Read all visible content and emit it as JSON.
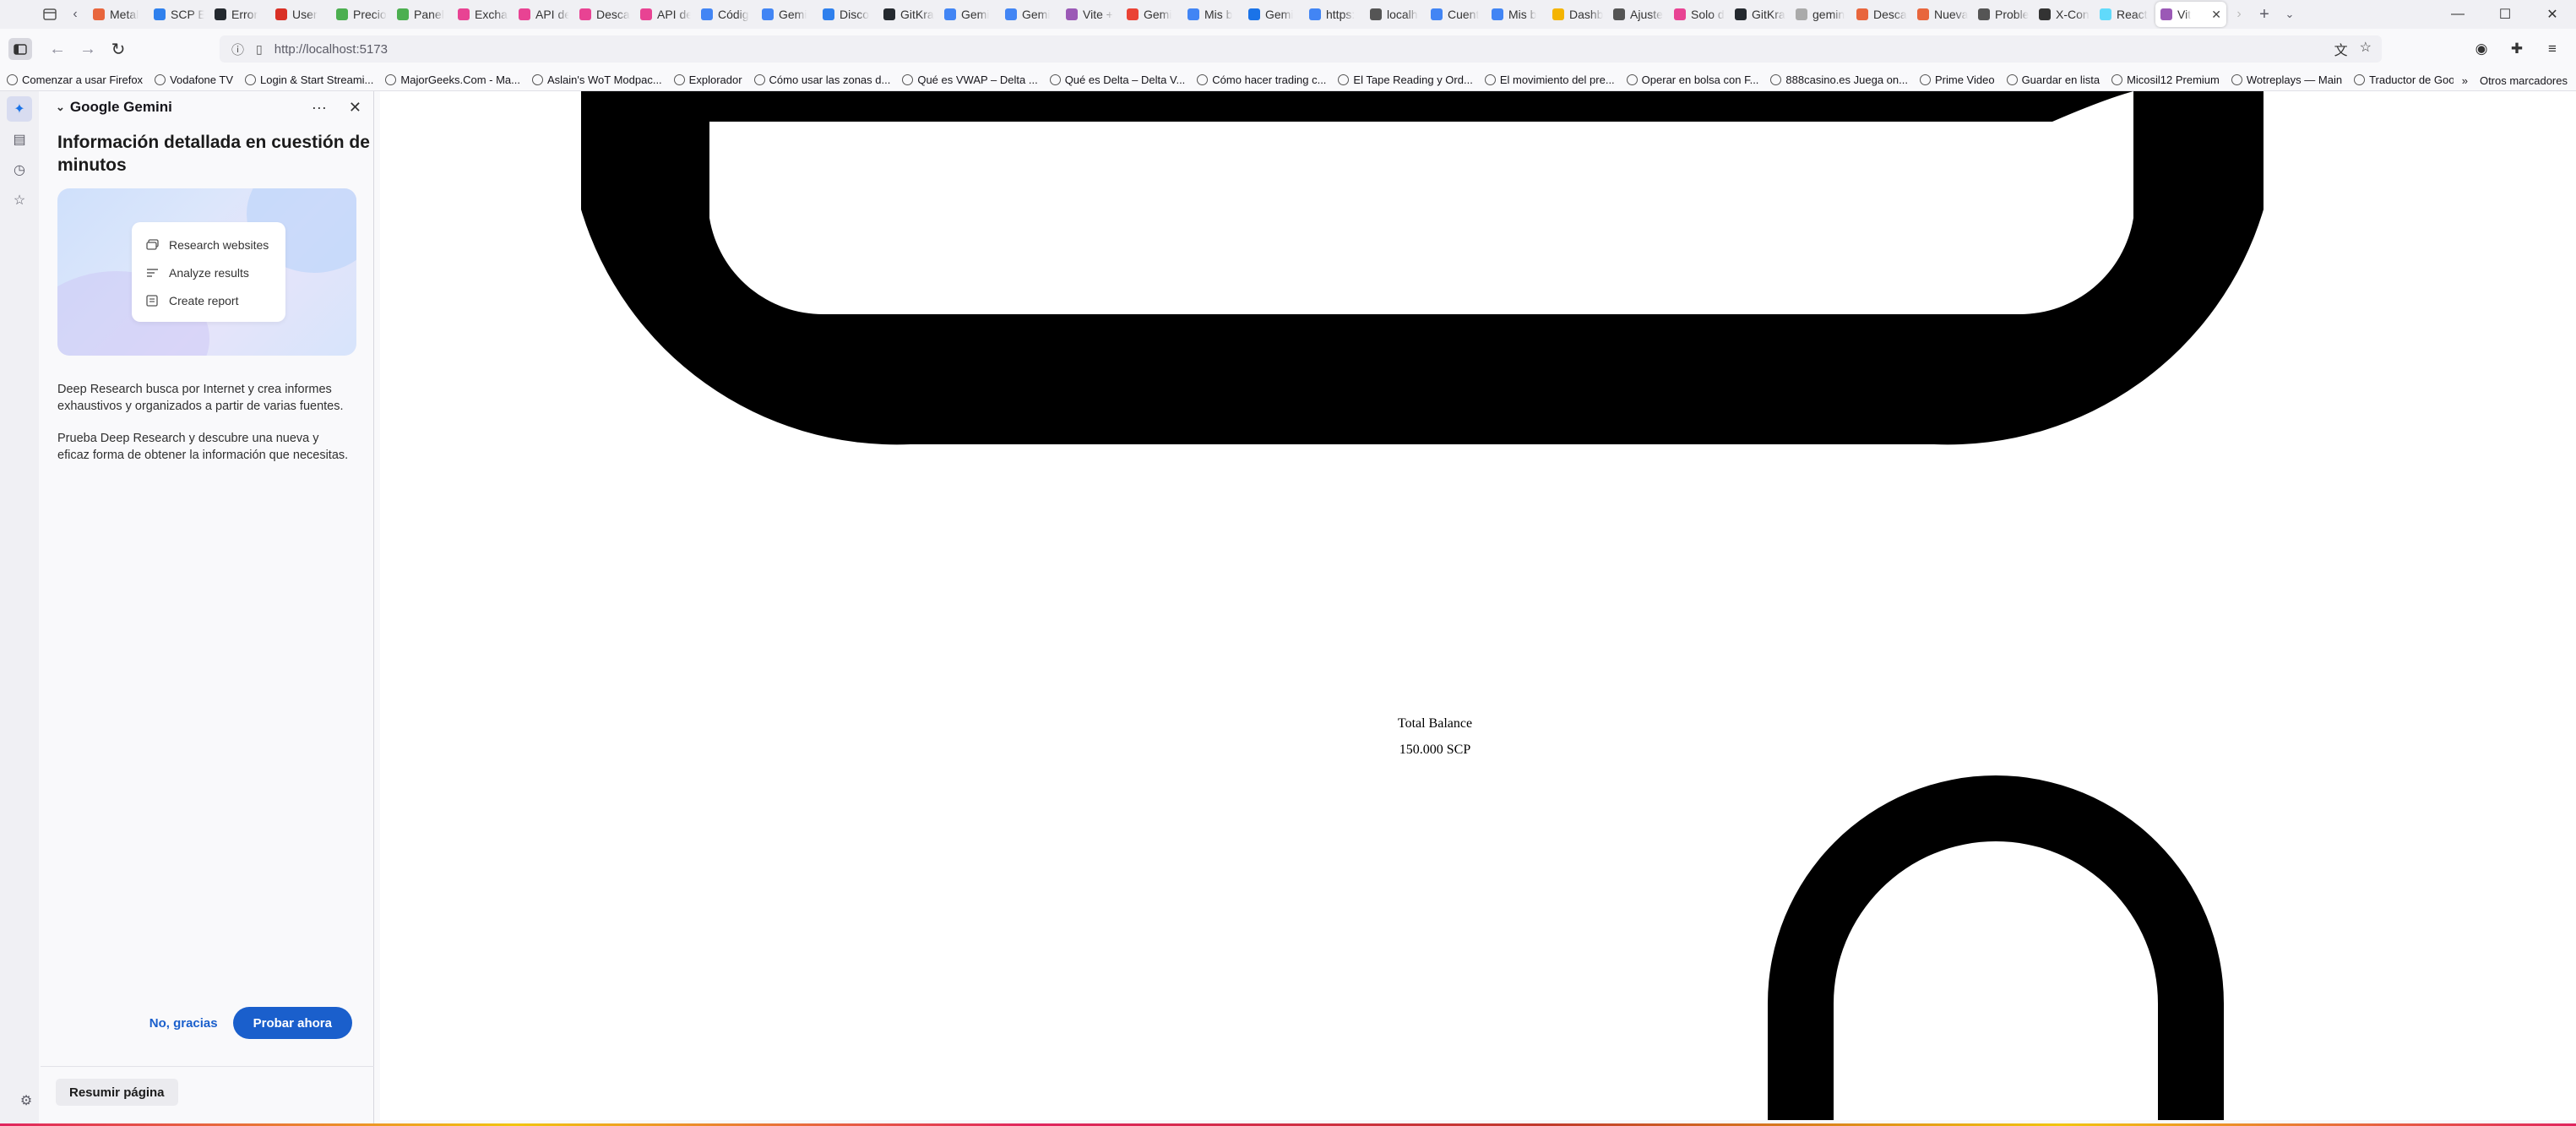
{
  "browser": {
    "tabs": [
      {
        "title": "Metal",
        "color": "#e8663d"
      },
      {
        "title": "SCP E",
        "color": "#2f80ed"
      },
      {
        "title": "Error",
        "color": "#24292f"
      },
      {
        "title": "User",
        "color": "#d93025"
      },
      {
        "title": "Precio",
        "color": "#4caf50"
      },
      {
        "title": "Panel",
        "color": "#4caf50"
      },
      {
        "title": "Exchai",
        "color": "#e84393"
      },
      {
        "title": "API de",
        "color": "#e84393"
      },
      {
        "title": "Desca",
        "color": "#e84393"
      },
      {
        "title": "API de",
        "color": "#e84393"
      },
      {
        "title": "Códig",
        "color": "#4285f4"
      },
      {
        "title": "Gemi",
        "color": "#4285f4"
      },
      {
        "title": "Disco",
        "color": "#2f80ed"
      },
      {
        "title": "GitKra",
        "color": "#24292f"
      },
      {
        "title": "Gemi",
        "color": "#4285f4"
      },
      {
        "title": "Gemi",
        "color": "#4285f4"
      },
      {
        "title": "Vite +",
        "color": "#9b59b6"
      },
      {
        "title": "Gemi",
        "color": "#ea4335"
      },
      {
        "title": "Mis b",
        "color": "#4285f4"
      },
      {
        "title": "Gemi",
        "color": "#1a73e8"
      },
      {
        "title": "https:",
        "color": "#4285f4"
      },
      {
        "title": "localh",
        "color": "#555555"
      },
      {
        "title": "Cuent",
        "color": "#4285f4"
      },
      {
        "title": "Mis b",
        "color": "#4285f4"
      },
      {
        "title": "Dashb",
        "color": "#f4b400"
      },
      {
        "title": "Ajuste",
        "color": "#555555"
      },
      {
        "title": "Solo d",
        "color": "#e84393"
      },
      {
        "title": "GitKra",
        "color": "#24292f"
      },
      {
        "title": "gemin",
        "color": "#aaaaaa"
      },
      {
        "title": "Desca",
        "color": "#e8663d"
      },
      {
        "title": "Nueva",
        "color": "#e8663d"
      },
      {
        "title": "Proble",
        "color": "#555555"
      },
      {
        "title": "X-Con",
        "color": "#333333"
      },
      {
        "title": "React",
        "color": "#61dafb"
      }
    ],
    "active_tab": {
      "title": "Vit",
      "color": "#9b59b6"
    },
    "url": "http://localhost:5173",
    "bookmarks": [
      "Comenzar a usar Firefox",
      "Vodafone TV",
      "Login & Start Streami...",
      "MajorGeeks.Com - Ma...",
      "Aslain's WoT Modpac...",
      "Explorador",
      "Cómo usar las zonas d...",
      "Qué es VWAP – Delta ...",
      "Qué es Delta – Delta V...",
      "Cómo hacer trading c...",
      "El Tape Reading y Ord...",
      "El movimiento del pre...",
      "Operar en bolsa con F...",
      "888casino.es Juega on...",
      "Prime Video",
      "Guardar en lista",
      "Micosil12 Premium",
      "Wotreplays — Main",
      "Traductor de Google"
    ],
    "other_bookmarks": "Otros marcadores"
  },
  "sidebar_panel": {
    "title": "Google Gemini",
    "heading": "Información detallada en cuestión de minutos",
    "steps": [
      "Research websites",
      "Analyze results",
      "Create report"
    ],
    "paragraph1": "Deep Research busca por Internet y crea informes exhaustivos y organizados a partir de varias fuentes.",
    "paragraph2": "Prueba Deep Research y descubre una nueva y eficaz forma de obtener la información que necesitas.",
    "no_thanks": "No, gracias",
    "try_now": "Probar ahora",
    "summarize": "Resumir página"
  },
  "page": {
    "balance_label": "Total Balance",
    "balance_value": "150.000 SCP"
  }
}
